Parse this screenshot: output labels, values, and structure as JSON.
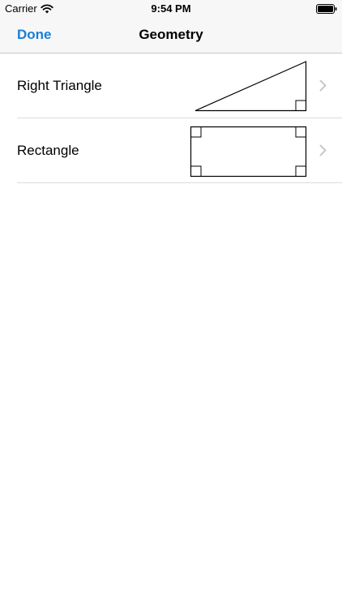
{
  "status_bar": {
    "carrier": "Carrier",
    "time": "9:54 PM",
    "icons": [
      "wifi-icon",
      "battery-icon"
    ]
  },
  "nav": {
    "done_label": "Done",
    "title": "Geometry"
  },
  "list": {
    "items": [
      {
        "label": "Right Triangle",
        "shape": "right-triangle"
      },
      {
        "label": "Rectangle",
        "shape": "rectangle"
      }
    ]
  },
  "colors": {
    "accent": "#1a7fd6",
    "bar_background": "#f7f7f7",
    "separator": "#dcdcdc",
    "chevron": "#c7c7cc"
  }
}
